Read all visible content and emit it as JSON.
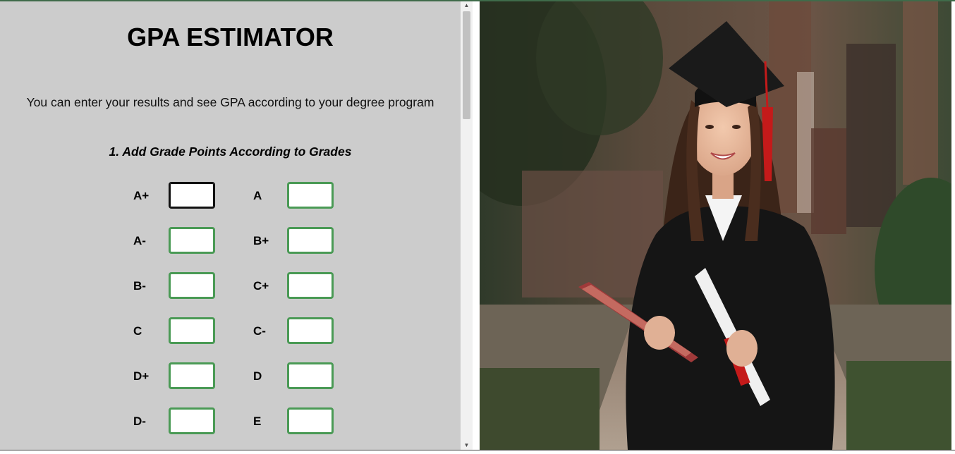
{
  "header": {
    "title": "GPA ESTIMATOR",
    "subtitle": "You can enter your results and see GPA according to your degree program"
  },
  "section": {
    "title": "1. Add Grade Points According to Grades"
  },
  "grades": [
    {
      "label": "A+",
      "value": ""
    },
    {
      "label": "A",
      "value": ""
    },
    {
      "label": "A-",
      "value": ""
    },
    {
      "label": "B+",
      "value": ""
    },
    {
      "label": "B-",
      "value": ""
    },
    {
      "label": "C+",
      "value": ""
    },
    {
      "label": "C",
      "value": ""
    },
    {
      "label": "C-",
      "value": ""
    },
    {
      "label": "D+",
      "value": ""
    },
    {
      "label": "D",
      "value": ""
    },
    {
      "label": "D-",
      "value": ""
    },
    {
      "label": "E",
      "value": ""
    }
  ],
  "colors": {
    "panel_bg": "#cccccc",
    "input_border": "#4a9a55",
    "focused_border": "#111111"
  },
  "icons": {
    "scroll_up": "triangle-up-icon",
    "scroll_down": "triangle-down-icon"
  }
}
